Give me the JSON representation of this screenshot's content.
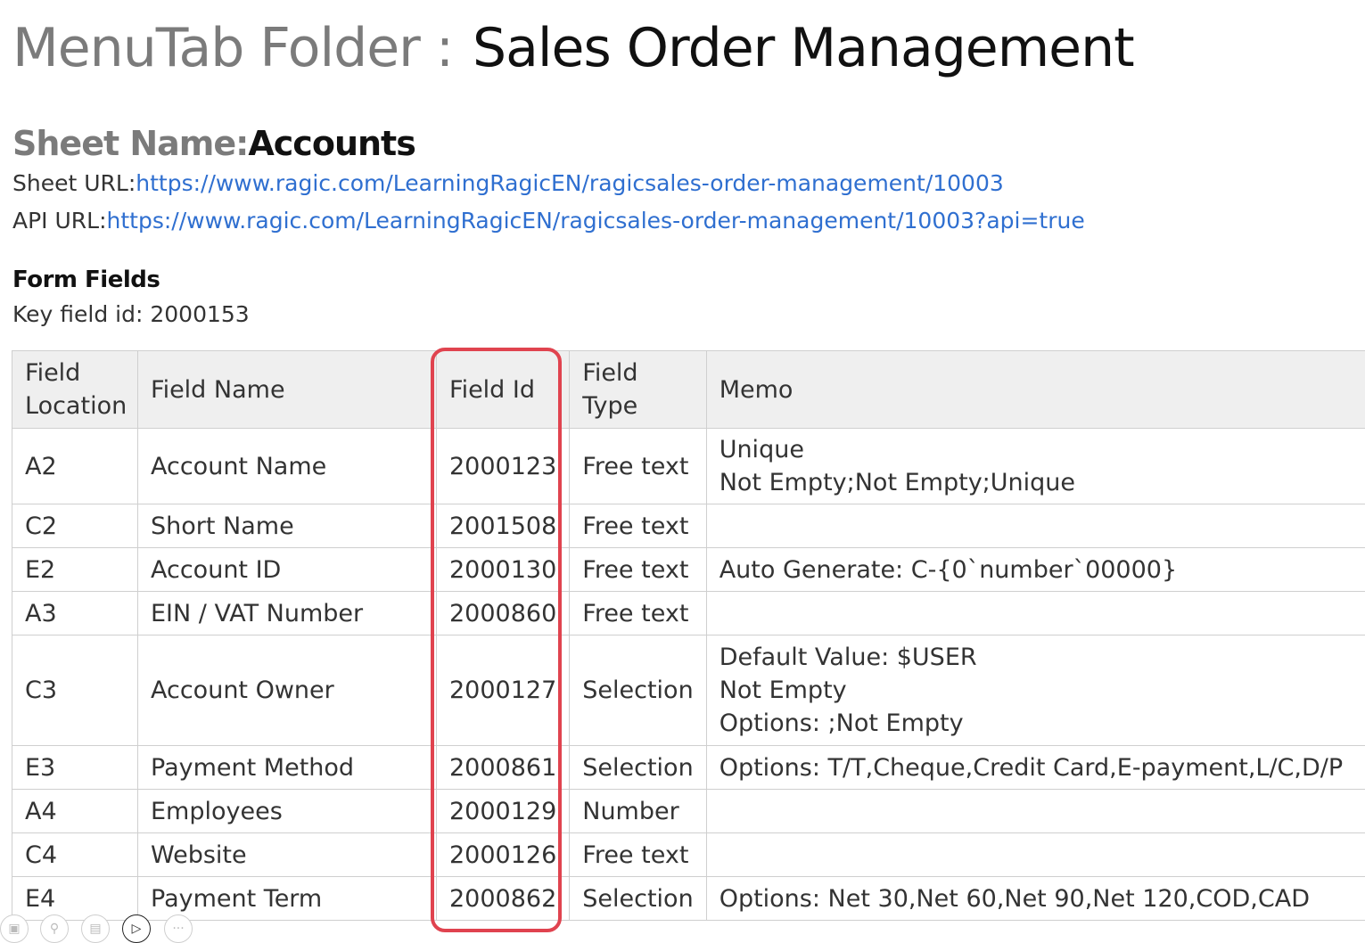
{
  "title": {
    "prefix": "MenuTab Folder",
    "separator": ":",
    "name": "Sales Order Management"
  },
  "sheet": {
    "label": "Sheet Name:",
    "name": "Accounts",
    "url_label": "Sheet URL:",
    "url": "https://www.ragic.com/LearningRagicEN/ragicsales-order-management/10003",
    "api_label": "API URL:",
    "api_url": "https://www.ragic.com/LearningRagicEN/ragicsales-order-management/10003?api=true"
  },
  "form_fields": {
    "heading": "Form Fields",
    "key_field": "Key field id: 2000153",
    "columns": [
      "Field Location",
      "Field Name",
      "Field Id",
      "Field Type",
      "Memo"
    ],
    "rows": [
      {
        "location": "A2",
        "name": "Account Name",
        "id": "2000123",
        "type": "Free text",
        "memo": [
          "Unique",
          "Not Empty;Not Empty;Unique"
        ]
      },
      {
        "location": "C2",
        "name": "Short Name",
        "id": "2001508",
        "type": "Free text",
        "memo": []
      },
      {
        "location": "E2",
        "name": "Account ID",
        "id": "2000130",
        "type": "Free text",
        "memo": [
          "Auto Generate: C-{0`number`00000}"
        ]
      },
      {
        "location": "A3",
        "name": "EIN / VAT Number",
        "id": "2000860",
        "type": "Free text",
        "memo": []
      },
      {
        "location": "C3",
        "name": "Account Owner",
        "id": "2000127",
        "type": "Selection",
        "memo": [
          "Default Value: $USER",
          "Not Empty",
          "Options: ;Not Empty"
        ]
      },
      {
        "location": "E3",
        "name": "Payment Method",
        "id": "2000861",
        "type": "Selection",
        "memo": [
          "Options: T/T,Cheque,Credit Card,E-payment,L/C,D/P"
        ]
      },
      {
        "location": "A4",
        "name": "Employees",
        "id": "2000129",
        "type": "Number",
        "memo": []
      },
      {
        "location": "C4",
        "name": "Website",
        "id": "2000126",
        "type": "Free text",
        "memo": []
      },
      {
        "location": "E4",
        "name": "Payment Term",
        "id": "2000862",
        "type": "Selection",
        "memo": [
          "Options: Net 30,Net 60,Net 90,Net 120,COD,CAD"
        ]
      }
    ]
  },
  "highlight_color": "#e0434f",
  "link_color": "#2f6fd0",
  "dock_icons": [
    "building-icon",
    "search-icon",
    "monitor-icon",
    "video-camera-icon",
    "more-icon"
  ]
}
